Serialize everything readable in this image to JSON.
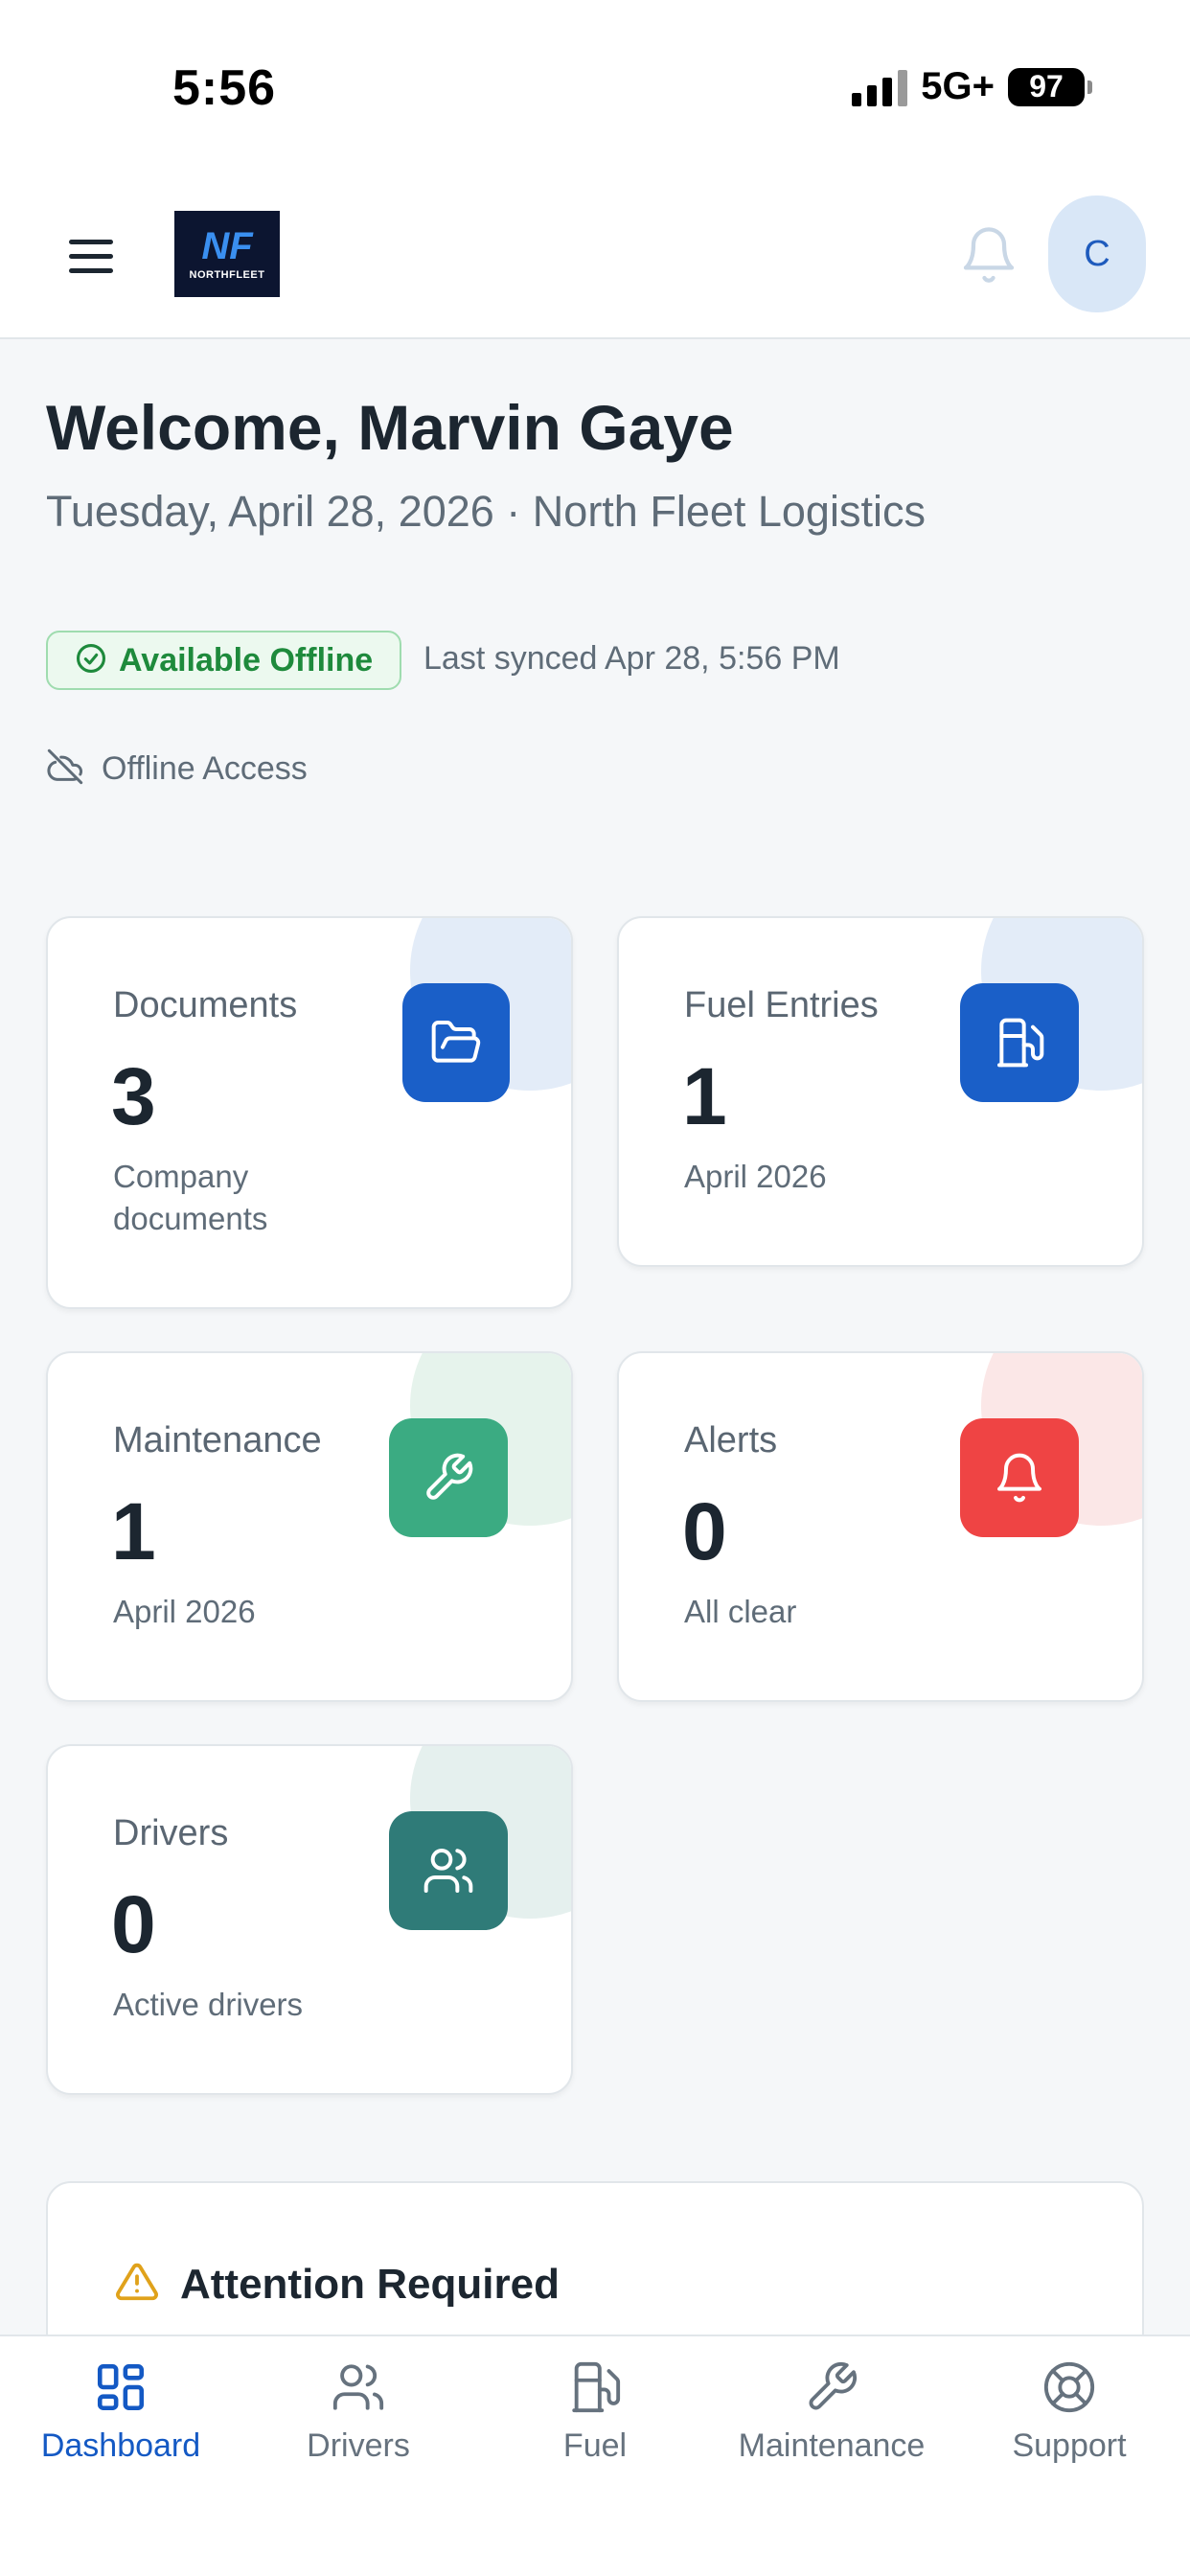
{
  "status_bar": {
    "time": "5:56",
    "network": "5G+",
    "battery": "97"
  },
  "header": {
    "logo_monogram": "NF",
    "logo_word": "NORTHFLEET",
    "avatar_initial": "C"
  },
  "welcome": {
    "title": "Welcome, Marvin Gaye",
    "subtitle": "Tuesday, April 28, 2026 · North Fleet Logistics",
    "offline_badge": "Available Offline",
    "last_synced": "Last synced Apr 28, 5:56 PM",
    "offline_access": "Offline Access"
  },
  "cards": [
    {
      "label": "Documents",
      "value": "3",
      "sub": "Company documents",
      "icon": "folder-open-icon",
      "color": "#1a5fc8"
    },
    {
      "label": "Fuel Entries",
      "value": "1",
      "sub": "April 2026",
      "icon": "fuel-pump-icon",
      "color": "#1a5fc8"
    },
    {
      "label": "Maintenance",
      "value": "1",
      "sub": "April 2026",
      "icon": "wrench-icon",
      "color": "#3bab82"
    },
    {
      "label": "Alerts",
      "value": "0",
      "sub": "All clear",
      "icon": "bell-icon",
      "color": "#ef4444"
    },
    {
      "label": "Drivers",
      "value": "0",
      "sub": "Active drivers",
      "icon": "users-icon",
      "color": "#2f7b78"
    }
  ],
  "attention": {
    "title": "Attention Required"
  },
  "bottom_nav": {
    "active_color": "#1459c4",
    "items": [
      {
        "label": "Dashboard",
        "icon": "grid-icon"
      },
      {
        "label": "Drivers",
        "icon": "users-icon"
      },
      {
        "label": "Fuel",
        "icon": "fuel-pump-icon"
      },
      {
        "label": "Maintenance",
        "icon": "wrench-icon"
      },
      {
        "label": "Support",
        "icon": "lifebuoy-icon"
      }
    ]
  }
}
